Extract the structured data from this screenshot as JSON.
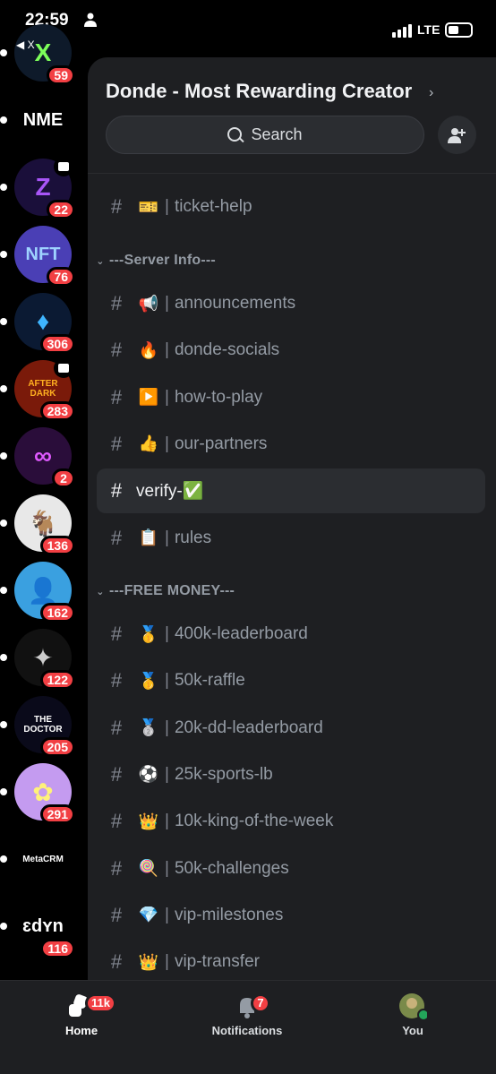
{
  "status_bar": {
    "time": "22:59",
    "network": "LTE",
    "back_label": "◀ X"
  },
  "servers": [
    {
      "name": "server-x",
      "badge": "59",
      "bg": "#0e1a2a",
      "text": "X",
      "text_color": "#7dff5a"
    },
    {
      "name": "server-nme",
      "badge": "",
      "bg": "#000000",
      "text": "NME",
      "text_color": "#ffffff"
    },
    {
      "name": "server-z",
      "badge": "22",
      "bg": "#1a0f3a",
      "text": "Z",
      "text_color": "#a855f7",
      "icon": "calendar-icon"
    },
    {
      "name": "server-nft",
      "badge": "76",
      "bg": "#4a3fb5",
      "text": "NFT",
      "text_color": "#9fd3ff"
    },
    {
      "name": "server-flame",
      "badge": "306",
      "bg": "#0b1a33",
      "text": "♦",
      "text_color": "#3fb5ff"
    },
    {
      "name": "server-after-dark",
      "badge": "283",
      "bg": "#7a1a0a",
      "text": "AFTER DARK",
      "text_color": "#ffb020",
      "icon": "screen-icon"
    },
    {
      "name": "server-knot",
      "badge": "2",
      "bg": "#2a0d3a",
      "text": "∞",
      "text_color": "#e05aff"
    },
    {
      "name": "server-goat",
      "badge": "136",
      "bg": "#e8e8e8",
      "text": "🐐",
      "text_color": "#000000"
    },
    {
      "name": "server-avatar",
      "badge": "162",
      "bg": "#3aa0e0",
      "text": "👤",
      "text_color": "#000000"
    },
    {
      "name": "server-dark-disc",
      "badge": "122",
      "bg": "#111111",
      "text": "✦",
      "text_color": "#cccccc"
    },
    {
      "name": "server-doctor",
      "badge": "205",
      "bg": "#0a0a1a",
      "text": "THE DOCTOR",
      "text_color": "#ffffff"
    },
    {
      "name": "server-pink",
      "badge": "291",
      "bg": "#c49bf0",
      "text": "✿",
      "text_color": "#fff27a"
    },
    {
      "name": "server-metacrm",
      "badge": "",
      "bg": "#000000",
      "text": "MetaCRM",
      "text_color": "#ffffff"
    },
    {
      "name": "server-edm",
      "badge": "116",
      "bg": "#000000",
      "text": "ɛdʏn",
      "text_color": "#ffffff"
    }
  ],
  "guild": {
    "name": "Donde - Most Rewarding Creator",
    "search_label": "Search"
  },
  "channels_top": [
    {
      "emoji": "🎫",
      "name": "ticket-help"
    }
  ],
  "categories": [
    {
      "label": "---Server Info---"
    },
    {
      "label": "---FREE MONEY---"
    }
  ],
  "server_info_channels": [
    {
      "emoji": "📢",
      "name": "announcements"
    },
    {
      "emoji": "🔥",
      "name": "donde-socials"
    },
    {
      "emoji": "▶️",
      "name": "how-to-play"
    },
    {
      "emoji": "👍",
      "name": "our-partners"
    },
    {
      "emoji": "",
      "name": "verify-✅",
      "active": true
    },
    {
      "emoji": "📋",
      "name": "rules"
    }
  ],
  "free_money_channels": [
    {
      "emoji": "🥇",
      "name": "400k-leaderboard"
    },
    {
      "emoji": "🥇",
      "name": "50k-raffle"
    },
    {
      "emoji": "🥈",
      "name": "20k-dd-leaderboard"
    },
    {
      "emoji": "⚽",
      "name": "25k-sports-lb"
    },
    {
      "emoji": "👑",
      "name": "10k-king-of-the-week"
    },
    {
      "emoji": "🍭",
      "name": "50k-challenges"
    },
    {
      "emoji": "💎",
      "name": "vip-milestones"
    },
    {
      "emoji": "👑",
      "name": "vip-transfer"
    }
  ],
  "nav": {
    "home_label": "Home",
    "home_badge": "11k",
    "notifications_label": "Notifications",
    "notifications_badge": "7",
    "you_label": "You"
  },
  "colors": {
    "accent_red": "#f23f43",
    "panel": "#1e1f22",
    "active_row": "#2b2d31"
  }
}
